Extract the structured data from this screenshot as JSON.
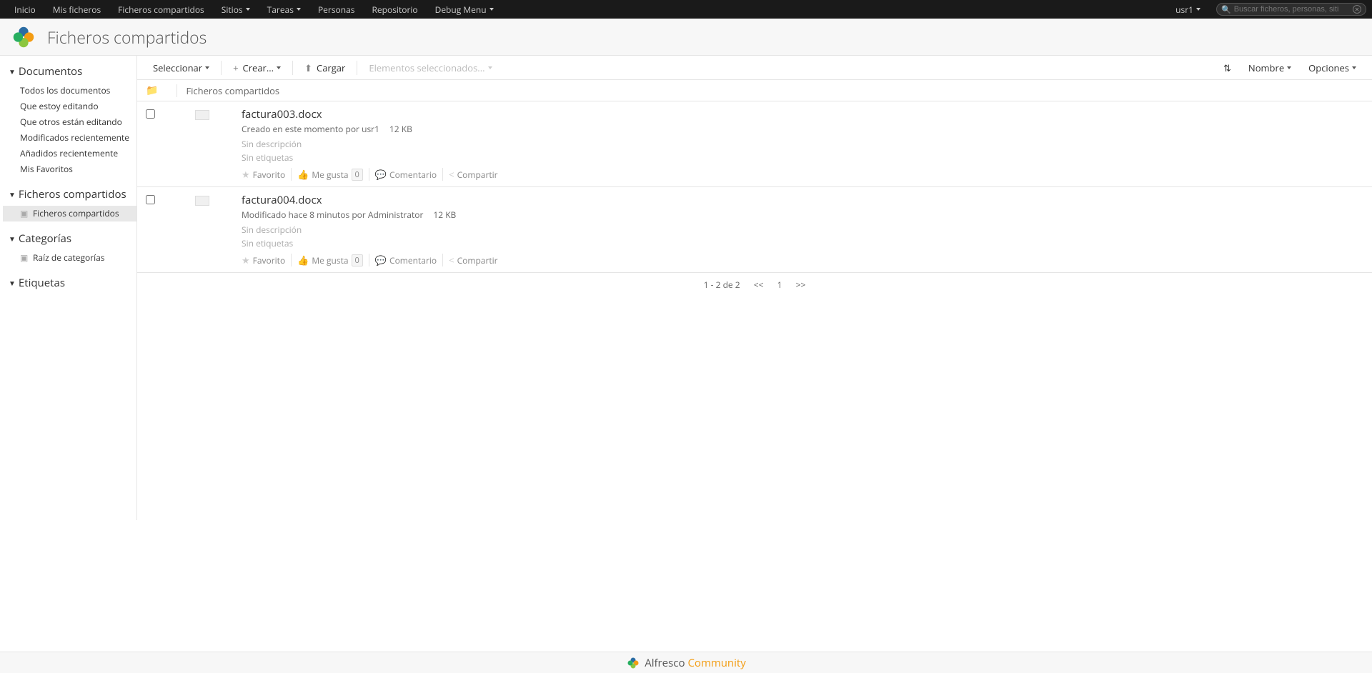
{
  "topnav": {
    "items": [
      {
        "label": "Inicio",
        "caret": false
      },
      {
        "label": "Mis ficheros",
        "caret": false
      },
      {
        "label": "Ficheros compartidos",
        "caret": false
      },
      {
        "label": "Sitios",
        "caret": true
      },
      {
        "label": "Tareas",
        "caret": true
      },
      {
        "label": "Personas",
        "caret": false
      },
      {
        "label": "Repositorio",
        "caret": false
      },
      {
        "label": "Debug Menu",
        "caret": true
      }
    ],
    "user": "usr1",
    "search_placeholder": "Buscar ficheros, personas, siti"
  },
  "header": {
    "title": "Ficheros compartidos"
  },
  "sidebar": {
    "sections": [
      {
        "title": "Documentos",
        "items": [
          {
            "label": "Todos los documentos",
            "icon": "",
            "active": false
          },
          {
            "label": "Que estoy editando",
            "icon": "",
            "active": false
          },
          {
            "label": "Que otros están editando",
            "icon": "",
            "active": false
          },
          {
            "label": "Modificados recientemente",
            "icon": "",
            "active": false
          },
          {
            "label": "Añadidos recientemente",
            "icon": "",
            "active": false
          },
          {
            "label": "Mis Favoritos",
            "icon": "",
            "active": false
          }
        ]
      },
      {
        "title": "Ficheros compartidos",
        "items": [
          {
            "label": "Ficheros compartidos",
            "icon": "📁",
            "active": true
          }
        ]
      },
      {
        "title": "Categorías",
        "items": [
          {
            "label": "Raíz de categorías",
            "icon": "🏷",
            "active": false
          }
        ]
      },
      {
        "title": "Etiquetas",
        "items": []
      }
    ]
  },
  "toolbar": {
    "select": "Seleccionar",
    "create": "Crear...",
    "upload": "Cargar",
    "selected": "Elementos seleccionados...",
    "sort_icon": "⇅",
    "name": "Nombre",
    "options": "Opciones"
  },
  "breadcrumb": {
    "label": "Ficheros compartidos"
  },
  "docs": [
    {
      "name": "factura003.docx",
      "meta": "Creado en este momento por usr1",
      "size": "12 KB",
      "desc": "Sin descripción",
      "tags": "Sin etiquetas",
      "like_count": "0"
    },
    {
      "name": "factura004.docx",
      "meta": "Modificado hace 8 minutos por Administrator",
      "size": "12 KB",
      "desc": "Sin descripción",
      "tags": "Sin etiquetas",
      "like_count": "0"
    }
  ],
  "actions": {
    "favorite": "Favorito",
    "like": "Me gusta",
    "comment": "Comentario",
    "share": "Compartir"
  },
  "pagination": {
    "range": "1 - 2 de 2",
    "prev": "<<",
    "page": "1",
    "next": ">>"
  },
  "footer": {
    "brand": "Alfresco",
    "edition": "Community"
  }
}
